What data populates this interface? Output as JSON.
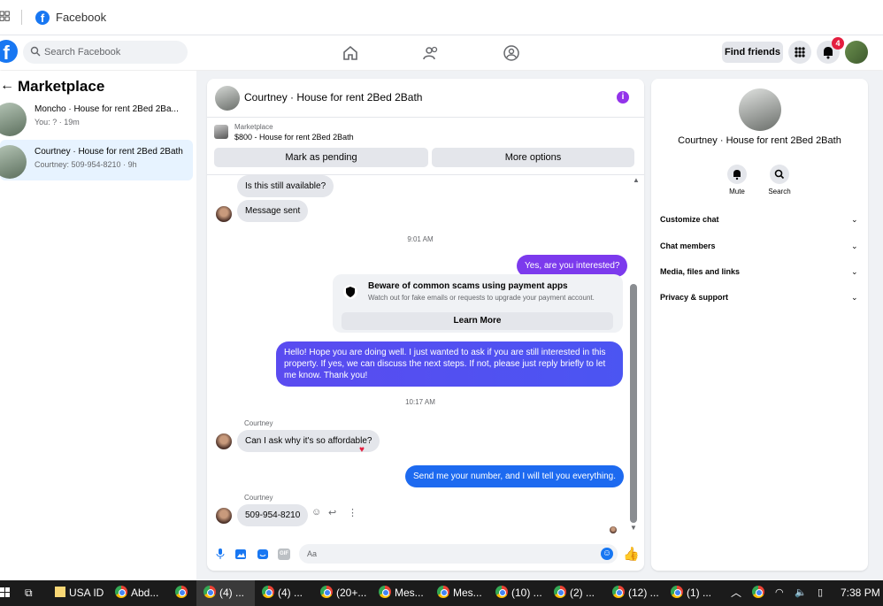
{
  "window": {
    "title": "Facebook"
  },
  "nav": {
    "search_placeholder": "Search Facebook",
    "find_friends": "Find friends",
    "notif_count": "4"
  },
  "left": {
    "title": "Marketplace",
    "conversations": [
      {
        "title": "Moncho · House for rent 2Bed 2Ba...",
        "sub": "You: ? · 19m"
      },
      {
        "title": "Courtney · House for rent 2Bed 2Bath",
        "sub": "Courtney: 509-954-8210 · 9h"
      }
    ]
  },
  "chat": {
    "name": "Courtney · House for rent 2Bed 2Bath",
    "listing_source": "Marketplace",
    "listing_title": "$800 - House for rent 2Bed 2Bath",
    "mark_pending": "Mark as pending",
    "more_options": "More options",
    "messages": {
      "m1": "Is this still available?",
      "m2": "Message sent",
      "t1": "9:01 AM",
      "m3": "Yes, are you interested?",
      "scam_title": "Beware of common scams using payment apps",
      "scam_sub": "Watch out for fake emails or requests to upgrade your payment account.",
      "learn_more": "Learn More",
      "m4": "Hello! Hope you are doing well. I just wanted to ask if you are still interested in this property. If yes, we can discuss the next steps. If not, please just reply briefly to let me know. Thank you!",
      "t2": "10:17 AM",
      "sender1": "Courtney",
      "m5": "Can I ask why it's so affordable?",
      "m6": "Send me your number, and I will tell you everything.",
      "sender2": "Courtney",
      "m7": "509-954-8210"
    },
    "composer_placeholder": "Aa"
  },
  "right": {
    "name": "Courtney · House for rent 2Bed 2Bath",
    "mute": "Mute",
    "search": "Search",
    "items": [
      "Customize chat",
      "Chat members",
      "Media, files and links",
      "Privacy & support"
    ]
  },
  "taskbar": {
    "items": [
      "USA ID",
      "Abd...",
      "",
      "(4) ...",
      "(4) ...",
      "(20+...",
      "Mes...",
      "Mes...",
      "(10) ...",
      "(2) ...",
      "(12) ...",
      "(1) ..."
    ],
    "time": "7:38 PM"
  },
  "colors": {
    "brand": "#1877f2",
    "outgoing": "#7c3aed",
    "outgoing_blue": "#1d6af0",
    "active_conv": "#e7f3ff"
  }
}
